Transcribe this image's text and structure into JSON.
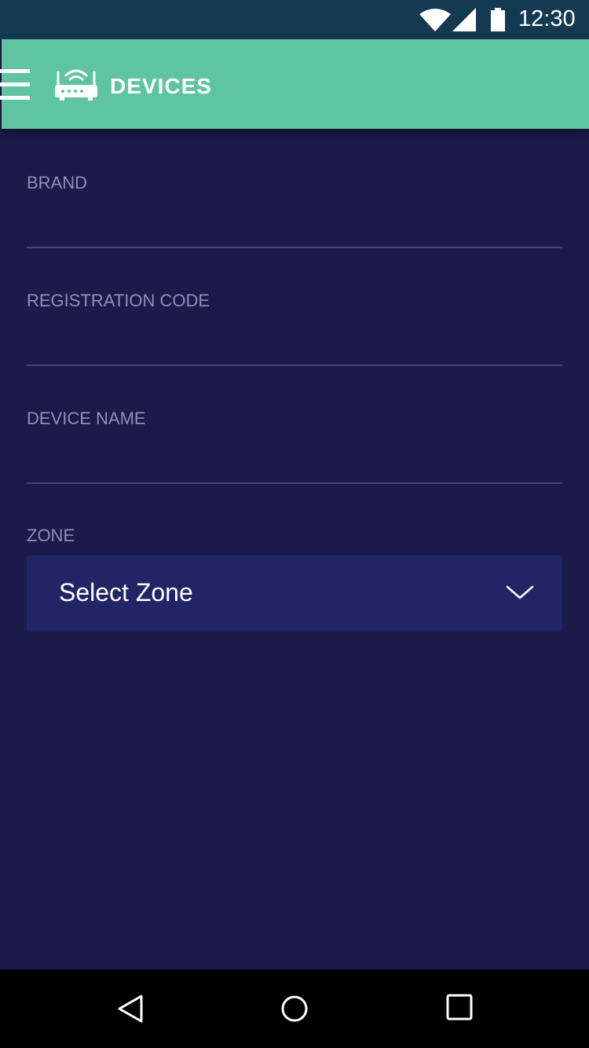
{
  "status_bar": {
    "time": "12:30",
    "icons": [
      "wifi-icon",
      "signal-icon",
      "battery-icon"
    ]
  },
  "header": {
    "title": "DEVICES",
    "menu_icon": "menu-icon",
    "logo_icon": "router-icon",
    "background_color": "#5fc4a2"
  },
  "form": {
    "brand": {
      "label": "BRAND",
      "value": "",
      "placeholder": ""
    },
    "registration_code": {
      "label": "REGISTRATION CODE",
      "value": "",
      "placeholder": ""
    },
    "device_name": {
      "label": "DEVICE NAME",
      "value": "",
      "placeholder": ""
    },
    "zone": {
      "label": "ZONE",
      "selected": "Select Zone"
    }
  },
  "nav_bar": {
    "icons": [
      "back-icon",
      "home-icon",
      "recents-icon"
    ]
  },
  "colors": {
    "background": "#1a1a4b",
    "status_bar": "#143a52",
    "select_background": "#212565",
    "label": "#8e8fb6"
  }
}
